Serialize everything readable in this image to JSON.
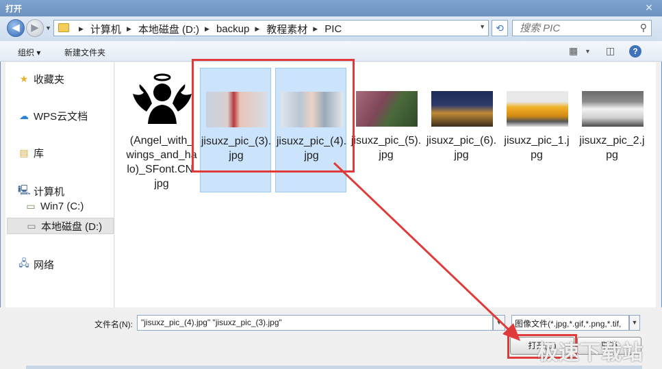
{
  "window": {
    "title": "打开",
    "close_icon": "close-icon"
  },
  "address": {
    "crumbs": [
      "计算机",
      "本地磁盘 (D:)",
      "backup",
      "教程素材",
      "PIC"
    ],
    "search_placeholder": "搜索 PIC"
  },
  "toolbar": {
    "organize_label": "组织 ▾",
    "new_folder_label": "新建文件夹"
  },
  "nav": {
    "favorites": "收藏夹",
    "wps_cloud": "WPS云文档",
    "libraries": "库",
    "computer": "计算机",
    "drive_c": "Win7 (C:)",
    "drive_d": "本地磁盘 (D:)",
    "network": "网络"
  },
  "files": [
    {
      "name": "(Angel_with_wings_and_halo)_SFont.CN.jpg",
      "selected": false
    },
    {
      "name": "jisuxz_pic_(3).jpg",
      "selected": true
    },
    {
      "name": "jisuxz_pic_(4).jpg",
      "selected": true
    },
    {
      "name": "jisuxz_pic_(5).jpg",
      "selected": false
    },
    {
      "name": "jisuxz_pic_(6).jpg",
      "selected": false
    },
    {
      "name": "jisuxz_pic_1.jpg",
      "selected": false
    },
    {
      "name": "jisuxz_pic_2.jpg",
      "selected": false
    }
  ],
  "footer": {
    "filename_label": "文件名(N):",
    "filename_value": "\"jisuxz_pic_(4).jpg\" \"jisuxz_pic_(3).jpg\"",
    "filter_value": "图像文件(*.jpg,*.gif,*.png,*.tif,",
    "open_label": "打开(O)",
    "cancel_label": "取消"
  },
  "watermark": "极速下载站",
  "colors": {
    "highlight": "#e03a3a",
    "selection": "#cce4fb",
    "titlebar": "#6d92c0"
  }
}
